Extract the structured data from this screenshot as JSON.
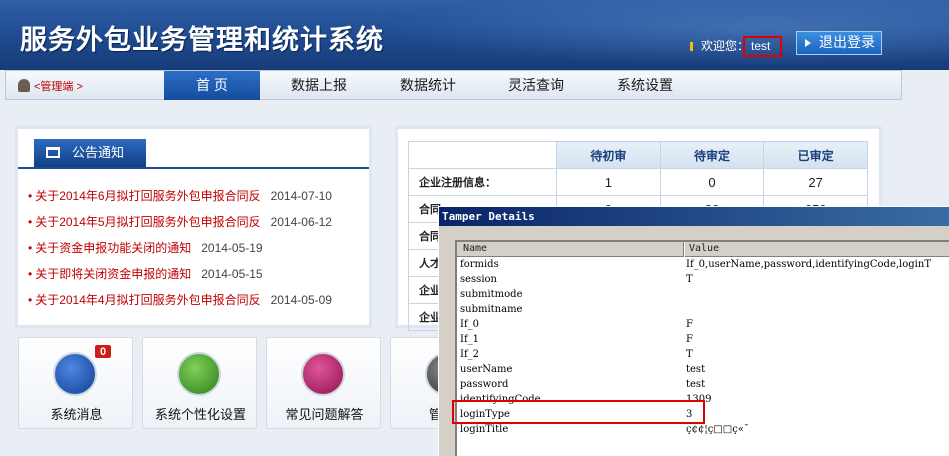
{
  "header": {
    "app_title": "服务外包业务管理和统计系统",
    "welcome_prefix": "欢迎您：",
    "username": "test",
    "logout_label": "退出登录"
  },
  "nav": {
    "admin_label": "<管理端 >",
    "items": [
      {
        "label": "首 页",
        "active": true
      },
      {
        "label": "数据上报"
      },
      {
        "label": "数据统计"
      },
      {
        "label": "灵活查询"
      },
      {
        "label": "系统设置"
      }
    ]
  },
  "notice": {
    "title": "公告通知",
    "items": [
      {
        "title": "关于2014年6月拟打回服务外包申报合同反",
        "date": "2014-07-10"
      },
      {
        "title": "关于2014年5月拟打回服务外包申报合同反",
        "date": "2014-06-12"
      },
      {
        "title": "关于资金申报功能关闭的通知",
        "date": "2014-05-19"
      },
      {
        "title": "关于即将关闭资金申报的通知",
        "date": "2014-05-15"
      },
      {
        "title": "关于2014年4月拟打回服务外包申报合同反",
        "date": "2014-05-09"
      }
    ]
  },
  "stats": {
    "columns": [
      "待初审",
      "待审定",
      "已审定"
    ],
    "rows": [
      {
        "label": "企业注册信息：",
        "values": [
          "1",
          "0",
          "27"
        ]
      },
      {
        "label": "合同",
        "values": [
          "0",
          "20",
          "650"
        ]
      },
      {
        "label": "合同",
        "values": [
          "",
          "",
          ""
        ]
      },
      {
        "label": "人才",
        "values": [
          "",
          "",
          ""
        ]
      },
      {
        "label": "企业",
        "values": [
          "",
          "",
          ""
        ]
      },
      {
        "label": "企业",
        "values": [
          "",
          "",
          ""
        ]
      }
    ]
  },
  "tiles": [
    {
      "label": "系统消息",
      "badge": "0",
      "color": "#1f56b5"
    },
    {
      "label": "系统个性化设置",
      "color": "#3f9a2a"
    },
    {
      "label": "常见问题解答",
      "color": "#b6206b"
    },
    {
      "label": "管理第",
      "color": "#444444"
    }
  ],
  "tamper": {
    "title": "Tamper Details",
    "col_name": "Name",
    "col_value": "Value",
    "rows": [
      {
        "name": "formids",
        "value": "If_0,userName,password,identifyingCode,loginT"
      },
      {
        "name": "session",
        "value": "T"
      },
      {
        "name": "submitmode",
        "value": ""
      },
      {
        "name": "submitname",
        "value": ""
      },
      {
        "name": "If_0",
        "value": "F"
      },
      {
        "name": "If_1",
        "value": "F"
      },
      {
        "name": "If_2",
        "value": "T"
      },
      {
        "name": "userName",
        "value": "test"
      },
      {
        "name": "password",
        "value": "test"
      },
      {
        "name": "identifyingCode",
        "value": "1309"
      },
      {
        "name": "loginType",
        "value": "3"
      },
      {
        "name": "loginTitle",
        "value": "ç¢¢¦ç□□ç«¯"
      }
    ]
  },
  "colors": {
    "banner": "#1f4a8f",
    "accent_red": "#c00000",
    "highlight_box": "#e00000"
  }
}
